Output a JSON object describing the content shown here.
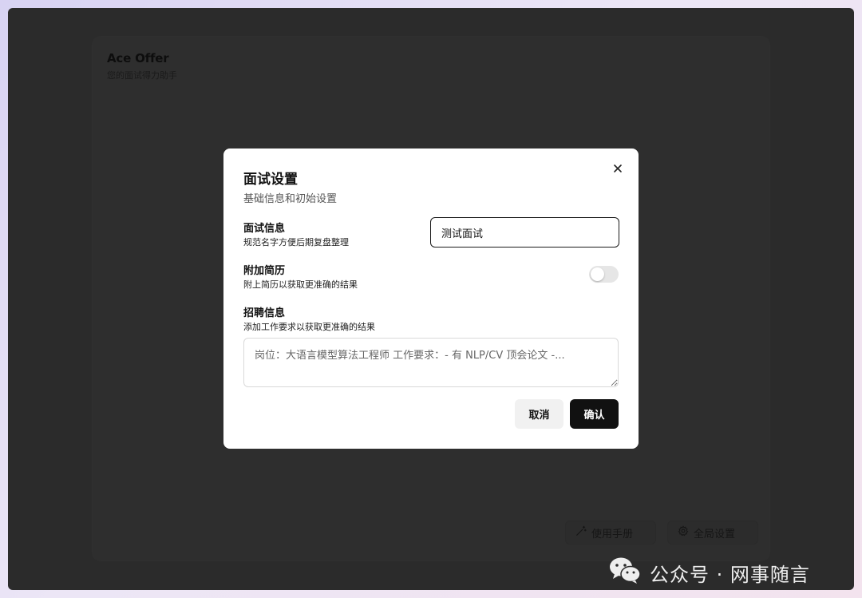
{
  "app": {
    "title": "Ace Offer",
    "subtitle": "您的面试得力助手"
  },
  "bottom_bar": {
    "manual_label": "使用手册",
    "manual_icon": "magic-wand-icon",
    "settings_label": "全局设置",
    "settings_icon": "gear-icon"
  },
  "modal": {
    "title": "面试设置",
    "subtitle": "基础信息和初始设置",
    "close_icon": "close-icon",
    "interview_info": {
      "label": "面试信息",
      "hint": "规范名字方便后期复盘整理",
      "value": "测试面试"
    },
    "attach_resume": {
      "label": "附加简历",
      "hint": "附上简历以获取更准确的结果",
      "enabled": false
    },
    "job_info": {
      "label": "招聘信息",
      "hint": "添加工作要求以获取更准确的结果",
      "value": "岗位：大语言模型算法工程师 工作要求：- 有 NLP/CV 顶会论文 -..."
    },
    "cancel_label": "取消",
    "confirm_label": "确认"
  },
  "watermark": {
    "text": "公众号 · 网事随言",
    "icon": "wechat-icon"
  },
  "colors": {
    "overlay": "#2b2b2b",
    "modal_bg": "#ffffff",
    "primary_button": "#111111",
    "secondary_button": "#f1f1f1",
    "toggle_off": "#e6e6e6"
  }
}
